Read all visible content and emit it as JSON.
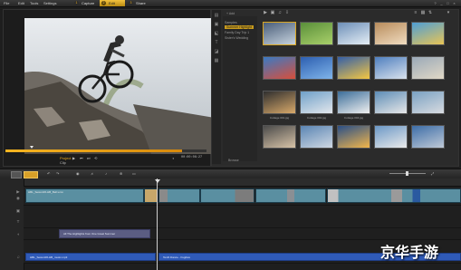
{
  "menu": [
    "File",
    "Edit",
    "Tools",
    "Settings"
  ],
  "steps": [
    {
      "num": "1",
      "label": "Capture",
      "active": false
    },
    {
      "num": "2",
      "label": "Edit",
      "active": true
    },
    {
      "num": "3",
      "label": "Share",
      "active": false
    }
  ],
  "window_controls": [
    "?",
    "_",
    "□",
    "×"
  ],
  "player": {
    "project_label": "Project",
    "clip_label": "Clip",
    "timecode": "00:00:06:27",
    "progress": 0.88
  },
  "library": {
    "add_label": "+ Add",
    "folders": [
      "Samples",
      "Summer Highlight",
      "Family Day Trip 1",
      "Sister's Wedding"
    ],
    "selected_folder": 1,
    "browse_label": "Browse",
    "thumbs": [
      {
        "cap": "",
        "colors": [
          "#4a5e7a",
          "#c7d3de"
        ]
      },
      {
        "cap": "",
        "colors": [
          "#5a8f3a",
          "#a9d06a"
        ]
      },
      {
        "cap": "",
        "colors": [
          "#6d8fb8",
          "#e5eef5"
        ]
      },
      {
        "cap": "",
        "colors": [
          "#b88c5c",
          "#f0dcc0"
        ]
      },
      {
        "cap": "",
        "colors": [
          "#4e9ed5",
          "#e8c455"
        ]
      },
      {
        "cap": "",
        "colors": [
          "#3a7ac4",
          "#d84f3b"
        ]
      },
      {
        "cap": "",
        "colors": [
          "#2d5fb0",
          "#7fb4ea"
        ]
      },
      {
        "cap": "",
        "colors": [
          "#345fa8",
          "#f4c742"
        ]
      },
      {
        "cap": "",
        "colors": [
          "#4f7fbf",
          "#d9e2ec"
        ]
      },
      {
        "cap": "",
        "colors": [
          "#9aa9b8",
          "#e1d8c6"
        ]
      },
      {
        "cap": "Cottage 001.jpg",
        "colors": [
          "#2f2f2f",
          "#d8a96a"
        ]
      },
      {
        "cap": "Cottage 002.jpg",
        "colors": [
          "#6fa0c8",
          "#e3e7ec"
        ]
      },
      {
        "cap": "Cottage 004.jpg",
        "colors": [
          "#3c6e9a",
          "#f0f0f0"
        ]
      },
      {
        "cap": "",
        "colors": [
          "#5d8db6",
          "#e7e7e7"
        ]
      },
      {
        "cap": "",
        "colors": [
          "#7aa1c2",
          "#d8dbe0"
        ]
      },
      {
        "cap": "",
        "colors": [
          "#4b4b4b",
          "#d7c3a7"
        ]
      },
      {
        "cap": "",
        "colors": [
          "#5a85b3",
          "#cfd8e3"
        ]
      },
      {
        "cap": "",
        "colors": [
          "#2a4f87",
          "#f1b64b"
        ]
      },
      {
        "cap": "",
        "colors": [
          "#6b98c6",
          "#eaeaea"
        ]
      },
      {
        "cap": "",
        "colors": [
          "#3d6ea8",
          "#bfc9d6"
        ]
      }
    ]
  },
  "timeline": {
    "video_clips": [
      {
        "label": "HBL_Sesion06-HB_Bell.wmv",
        "color": "teal"
      },
      {
        "label": "",
        "color": "thumb"
      },
      {
        "label": "",
        "color": "teal"
      },
      {
        "label": "",
        "color": "teal"
      },
      {
        "label": "",
        "color": "teal"
      }
    ],
    "title_clip": "All The Highlights from One Great Summer",
    "music_clips": [
      "HBL_Sesion06-HB_music.mp3",
      "Tenth Dance - Fugitive"
    ]
  },
  "watermark": "京华手游"
}
